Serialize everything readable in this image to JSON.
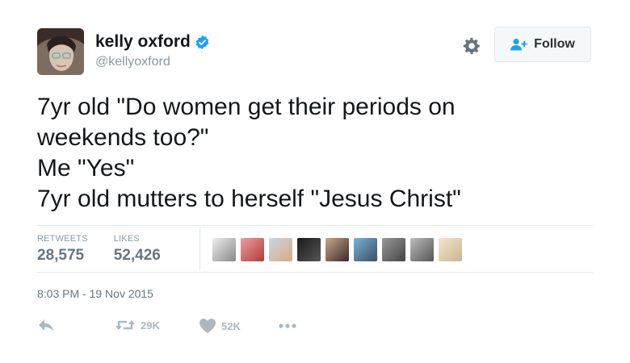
{
  "tweet": {
    "display_name": "kelly oxford",
    "handle": "@kellyoxford",
    "text_lines": [
      "7yr old \"Do women get their periods on",
      "weekends too?\"",
      "Me \"Yes\"",
      "7yr old mutters to herself \"Jesus Christ\""
    ],
    "follow_label": "Follow",
    "retweets_label": "RETWEETS",
    "retweets_count": "28,575",
    "likes_label": "LIKES",
    "likes_count": "52,426",
    "timestamp": "8:03 PM - 19 Nov 2015",
    "retweet_short": "29K",
    "like_short": "52K"
  },
  "colors": {
    "verified": "#1da1f2",
    "follow_accent": "#1da1f2",
    "muted": "#8899a6",
    "action": "#aab8c2"
  },
  "icons": [
    "verified-badge-icon",
    "gear-icon",
    "add-user-icon",
    "reply-icon",
    "retweet-icon",
    "heart-icon",
    "more-icon"
  ]
}
